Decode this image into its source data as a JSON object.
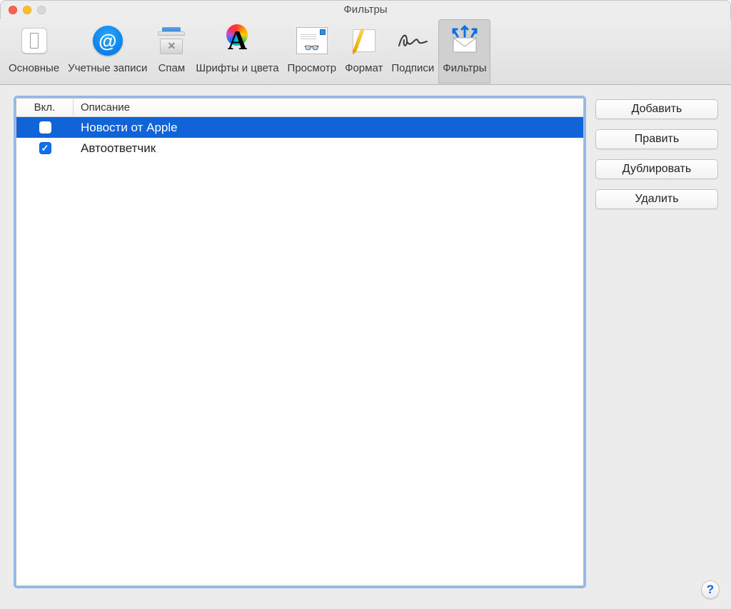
{
  "window": {
    "title": "Фильтры"
  },
  "toolbar": {
    "items": [
      {
        "id": "general",
        "label": "Основные"
      },
      {
        "id": "accounts",
        "label": "Учетные записи",
        "at": "@"
      },
      {
        "id": "junk",
        "label": "Спам",
        "x": "✕"
      },
      {
        "id": "fonts",
        "label": "Шрифты и цвета",
        "glyph": "A"
      },
      {
        "id": "viewing",
        "label": "Просмотр",
        "glasses": "👓"
      },
      {
        "id": "composing",
        "label": "Формат"
      },
      {
        "id": "signatures",
        "label": "Подписи"
      },
      {
        "id": "rules",
        "label": "Фильтры"
      }
    ]
  },
  "list": {
    "headers": {
      "enabled": "Вкл.",
      "description": "Описание"
    },
    "rows": [
      {
        "enabled": false,
        "description": "Новости от Apple",
        "selected": true
      },
      {
        "enabled": true,
        "description": "Автоответчик",
        "selected": false
      }
    ]
  },
  "buttons": {
    "add": "Добавить",
    "edit": "Править",
    "duplicate": "Дублировать",
    "delete": "Удалить"
  },
  "help": {
    "glyph": "?"
  }
}
